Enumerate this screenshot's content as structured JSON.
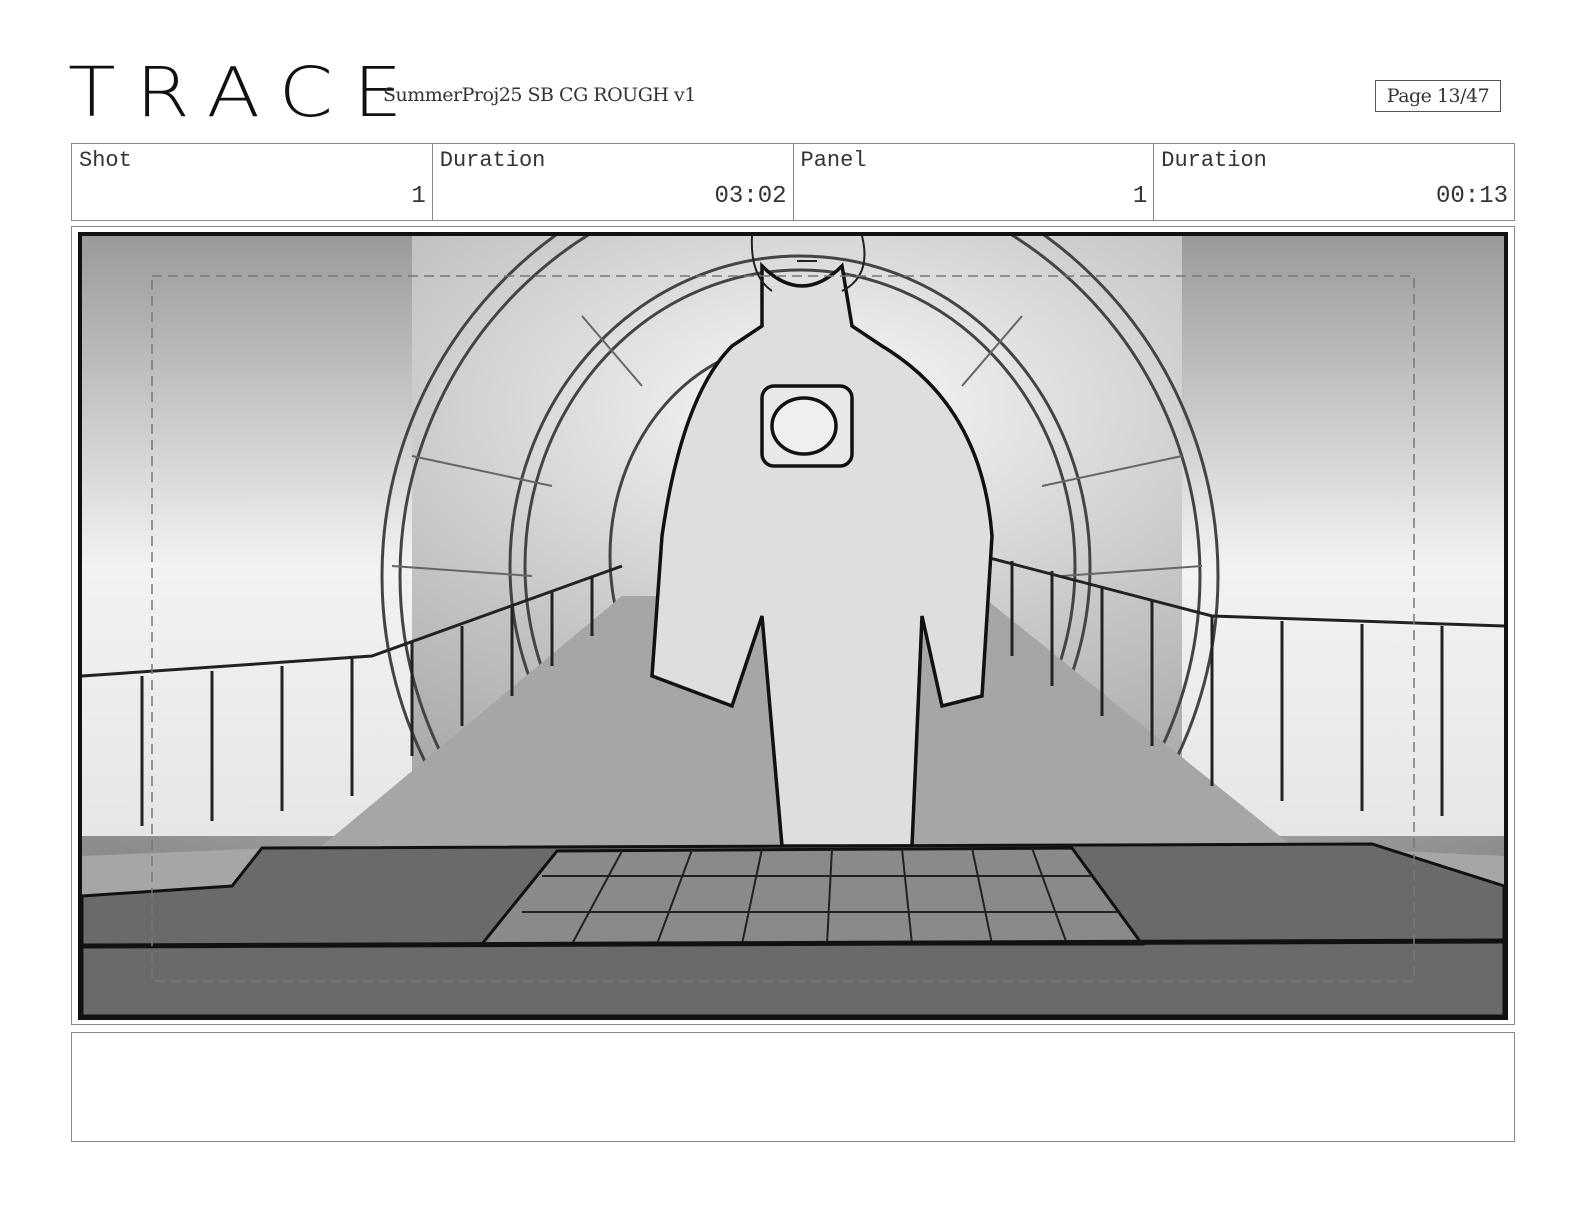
{
  "header": {
    "logo_text": "TRACE",
    "project_title": "SummerProj25 SB CG ROUGH v1",
    "page_label": "Page 13/47"
  },
  "info": {
    "shot_label": "Shot",
    "shot_value": "1",
    "shot_duration_label": "Duration",
    "shot_duration_value": "03:02",
    "panel_label": "Panel",
    "panel_value": "1",
    "panel_duration_label": "Duration",
    "panel_duration_value": "00:13"
  },
  "notes": {
    "text": ""
  }
}
